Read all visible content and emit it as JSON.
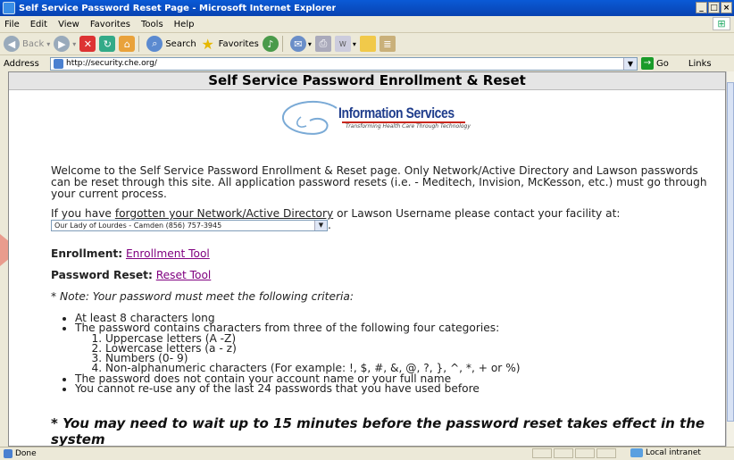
{
  "window": {
    "title": "Self Service Password Reset Page - Microsoft Internet Explorer",
    "buttons": [
      "_",
      "□",
      "×"
    ]
  },
  "menu": [
    "File",
    "Edit",
    "View",
    "Favorites",
    "Tools",
    "Help"
  ],
  "toolbar": {
    "back": "Back",
    "search": "Search",
    "favorites": "Favorites"
  },
  "address": {
    "label": "Address",
    "url": "http://security.che.org/",
    "go": "Go",
    "links": "Links"
  },
  "page": {
    "heading": "Self Service Password Enrollment & Reset",
    "logo_title": "Information Services",
    "logo_tagline": "Transforming Health Care Through Technology",
    "welcome": "Welcome to the Self Service Password Enrollment & Reset page. Only Network/Active Directory and Lawson passwords can be reset through this site. All application password resets (i.e. - Meditech, Invision, McKesson, etc.) must go through your current process.",
    "forgot_prefix": "If you have ",
    "forgot_underlined": "forgotten your Network/Active Directory",
    "forgot_suffix": " or Lawson Username please contact your facility at:",
    "facility_selected": "Our Lady of Lourdes - Camden (856) 757-3945",
    "period": ".",
    "enrollment_label": "Enrollment:",
    "enrollment_link": "Enrollment Tool",
    "reset_label": "Password Reset:",
    "reset_link": "Reset Tool",
    "note": "* Note: Your password must meet the following criteria:",
    "criteria": [
      "At least 8 characters long",
      "The password contains characters from three of the following four categories:",
      "The password does not contain your account name or your full name",
      "You cannot re-use any of the last 24 passwords that you have used before"
    ],
    "categories": [
      "Uppercase letters (A -Z)",
      "Lowercase letters (a - z)",
      "Numbers (0- 9)",
      "Non-alphanumeric characters (For example: !, $, #, &, @, ?, }, ^, *, + or %)"
    ],
    "wait_notice": "* You may need to wait up to 15 minutes before the password reset takes effect in the system"
  },
  "status": {
    "text": "Done",
    "zone": "Local intranet"
  }
}
